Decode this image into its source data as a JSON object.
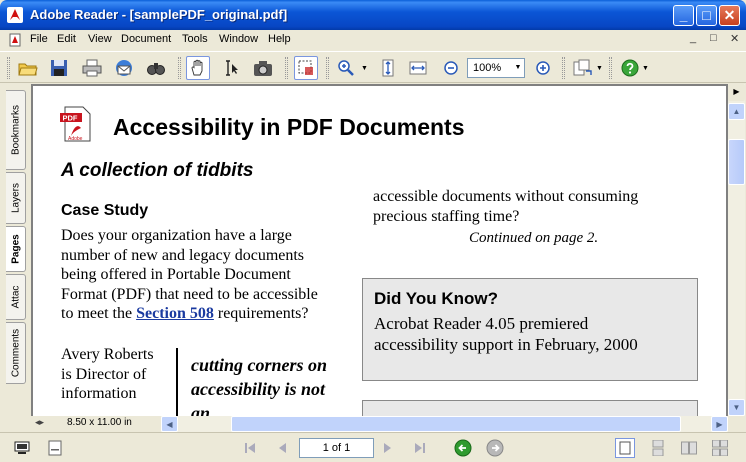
{
  "window": {
    "title": "Adobe Reader - [samplePDF_original.pdf]",
    "min_label": "_",
    "max_label": "□",
    "close_label": "✕"
  },
  "menu": {
    "items": [
      "File",
      "Edit",
      "View",
      "Document",
      "Tools",
      "Window",
      "Help"
    ],
    "mdi": [
      "_",
      "□",
      "✕"
    ]
  },
  "toolbar": {
    "zoom_value": "100%"
  },
  "nav_tabs": [
    "Bookmarks",
    "Layers",
    "Pages",
    "Attac",
    "Comments"
  ],
  "document": {
    "title": "Accessibility in PDF Documents",
    "subtitle": "A collection of tidbits",
    "case_heading": "Case Study",
    "para_before_link": "Does your organization have a large number of new and legacy documents being offered in Portable Document Format (PDF) that need to be accessible to meet the ",
    "link_text": "Section 508",
    "para_after_link": " requirements?",
    "narrow_text": "Avery Roberts is Director of information",
    "pull_quote": "cutting corners on accessibility is not an",
    "right_para": "accessible documents without consuming precious staffing time?",
    "continued": "Continued on page 2.",
    "did_you_know_heading": "Did You Know?",
    "did_you_know_body": "Acrobat Reader 4.05 premiered accessibility support in February, 2000"
  },
  "status": {
    "page_size": "8.50 x 11.00 in",
    "page_indicator": "1 of 1"
  }
}
